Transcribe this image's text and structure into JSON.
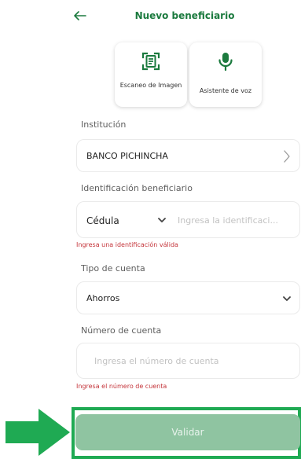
{
  "header": {
    "title": "Nuevo beneficiario",
    "back_icon": "arrow-left-icon"
  },
  "actions": {
    "scan_label": "Escaneo de Imagen",
    "scan_icon": "document-scan-icon",
    "voice_label": "Asistente de voz",
    "voice_icon": "microphone-icon"
  },
  "institucion": {
    "label": "Institución",
    "value": "BANCO PICHINCHA",
    "icon": "chevron-right-icon"
  },
  "identificacion": {
    "label": "Identificación beneficiario",
    "type_value": "Cédula",
    "type_icon": "chevron-down-icon",
    "placeholder": "Ingresa la identificaci...",
    "error": "Ingresa una identificación válida"
  },
  "tipo_cuenta": {
    "label": "Tipo de cuenta",
    "value": "Ahorros",
    "icon": "chevron-down-icon"
  },
  "numero_cuenta": {
    "label": "Número de cuenta",
    "placeholder": "Ingresa el número de cuenta",
    "error": "Ingresa el número de cuenta"
  },
  "submit": {
    "label": "Validar"
  },
  "colors": {
    "brand_green": "#1b7a3e",
    "button_disabled": "#8fc4a1",
    "highlight_green": "#1faa53",
    "error_red": "#c4343a"
  }
}
